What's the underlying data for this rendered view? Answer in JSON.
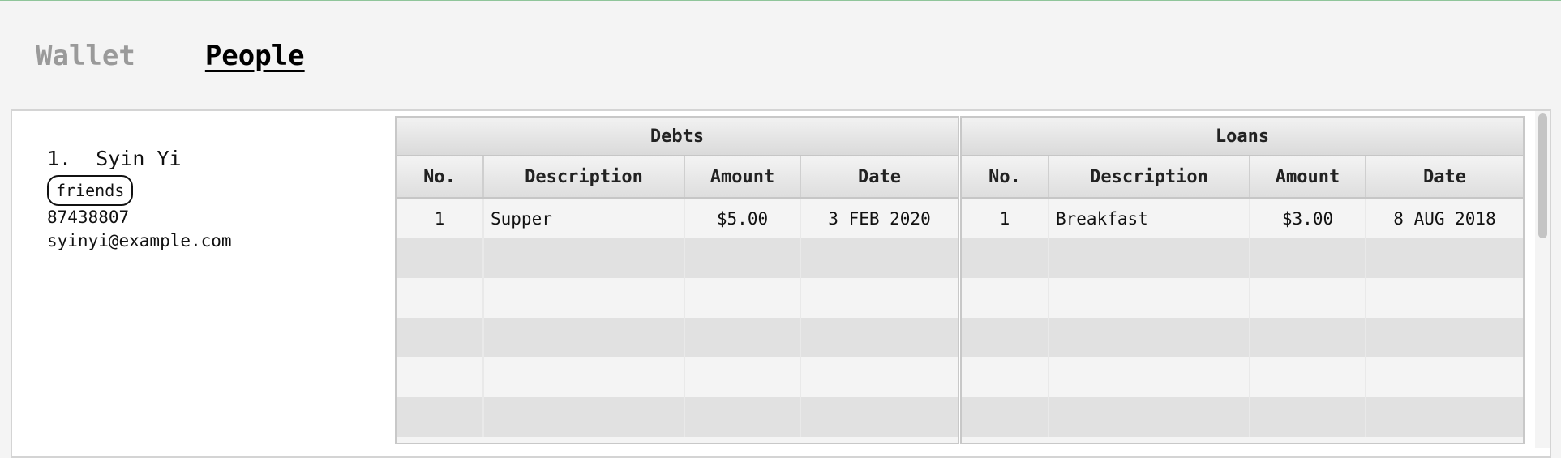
{
  "tabs": [
    {
      "label": "Wallet",
      "active": false
    },
    {
      "label": "People",
      "active": true
    }
  ],
  "person": {
    "index": "1.",
    "name": "Syin Yi",
    "tag": "friends",
    "phone": "87438807",
    "email": "syinyi@example.com"
  },
  "debts": {
    "title": "Debts",
    "columns": [
      "No.",
      "Description",
      "Amount",
      "Date"
    ],
    "rows": [
      {
        "no": "1",
        "description": "Supper",
        "amount": "$5.00",
        "date": "3 FEB 2020"
      }
    ]
  },
  "loans": {
    "title": "Loans",
    "columns": [
      "No.",
      "Description",
      "Amount",
      "Date"
    ],
    "rows": [
      {
        "no": "1",
        "description": "Breakfast",
        "amount": "$3.00",
        "date": "8 AUG 2018"
      }
    ]
  },
  "colors": {
    "accent_line": "#8fc59a",
    "active_tab": "#000000",
    "inactive_tab": "#9a9a9a"
  }
}
